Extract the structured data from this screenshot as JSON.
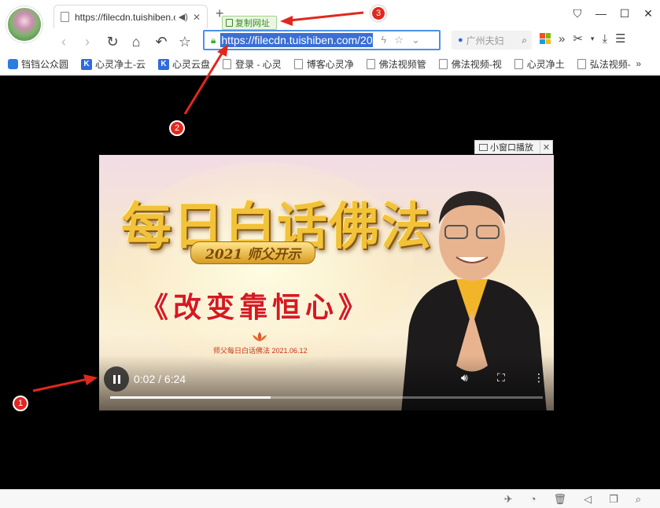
{
  "tab": {
    "title": "https://filecdn.tuishiben.c",
    "sound_icon": "speaker-icon",
    "close": "✕"
  },
  "new_tab": "+",
  "copy_tip": "复制网址",
  "window_controls": {
    "shirt": "⛉",
    "minimize": "—",
    "maximize": "☐",
    "close": "✕"
  },
  "address": {
    "url": "https://filecdn.tuishiben.com/20"
  },
  "search": {
    "placeholder": "广州夫妇"
  },
  "bookmarks": [
    {
      "label": "铛铛公众圆",
      "icon": "qq"
    },
    {
      "label": "心灵净土-云",
      "icon": "k"
    },
    {
      "label": "心灵云盘",
      "icon": "k"
    },
    {
      "label": "登录 - 心灵",
      "icon": "page"
    },
    {
      "label": "博客心灵净",
      "icon": "page"
    },
    {
      "label": "佛法视频管",
      "icon": "page"
    },
    {
      "label": "佛法视频-视",
      "icon": "page"
    },
    {
      "label": "心灵净土",
      "icon": "page"
    },
    {
      "label": "弘法视频-",
      "icon": "page"
    }
  ],
  "bookmarks_more": "»",
  "mini_player": {
    "label": "小窗口播放",
    "close": "✕"
  },
  "video": {
    "title": "每日白话佛法",
    "ribbon": "2021 师父开示",
    "subtitle": "《改变靠恒心》",
    "caption": "师父每日白话佛法 2021.06.12",
    "time": "0:02 / 6:24",
    "progress": 0.37
  },
  "badges": {
    "one": "1",
    "two": "2",
    "three": "3"
  },
  "colors": {
    "accent": "#3b6fd4",
    "annotation": "#e0281f",
    "subtitle_red": "#d7191f",
    "gold": "#f2c23a"
  }
}
